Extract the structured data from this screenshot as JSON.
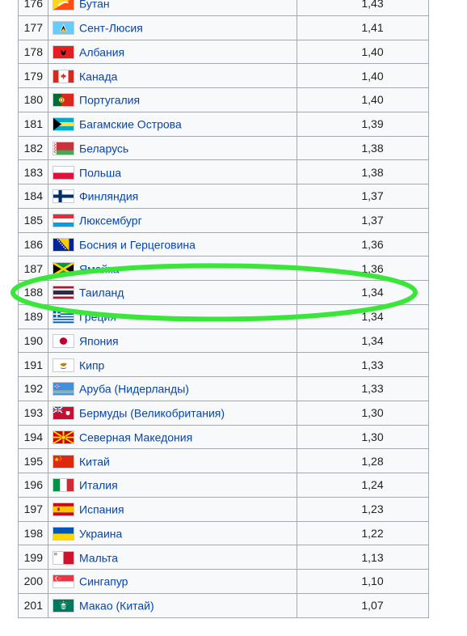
{
  "table": {
    "rows": [
      {
        "rank": "176",
        "country": "Бутан",
        "value": "1,43",
        "flag": "bhutan-flag-icon"
      },
      {
        "rank": "177",
        "country": "Сент-Люсия",
        "value": "1,41",
        "flag": "saint-lucia-flag-icon"
      },
      {
        "rank": "178",
        "country": "Албания",
        "value": "1,40",
        "flag": "albania-flag-icon"
      },
      {
        "rank": "179",
        "country": "Канада",
        "value": "1,40",
        "flag": "canada-flag-icon"
      },
      {
        "rank": "180",
        "country": "Португалия",
        "value": "1,40",
        "flag": "portugal-flag-icon"
      },
      {
        "rank": "181",
        "country": "Багамские Острова",
        "value": "1,39",
        "flag": "bahamas-flag-icon"
      },
      {
        "rank": "182",
        "country": "Беларусь",
        "value": "1,38",
        "flag": "belarus-flag-icon"
      },
      {
        "rank": "183",
        "country": "Польша",
        "value": "1,38",
        "flag": "poland-flag-icon"
      },
      {
        "rank": "184",
        "country": "Финляндия",
        "value": "1,37",
        "flag": "finland-flag-icon"
      },
      {
        "rank": "185",
        "country": "Люксембург",
        "value": "1,37",
        "flag": "luxembourg-flag-icon"
      },
      {
        "rank": "186",
        "country": "Босния и Герцеговина",
        "value": "1,36",
        "flag": "bosnia-flag-icon"
      },
      {
        "rank": "187",
        "country": "Ямайка",
        "value": "1,36",
        "flag": "jamaica-flag-icon"
      },
      {
        "rank": "188",
        "country": "Таиланд",
        "value": "1,34",
        "flag": "thailand-flag-icon"
      },
      {
        "rank": "189",
        "country": "Греция",
        "value": "1,34",
        "flag": "greece-flag-icon"
      },
      {
        "rank": "190",
        "country": "Япония",
        "value": "1,34",
        "flag": "japan-flag-icon"
      },
      {
        "rank": "191",
        "country": "Кипр",
        "value": "1,33",
        "flag": "cyprus-flag-icon"
      },
      {
        "rank": "192",
        "country": "Аруба (Нидерланды)",
        "value": "1,33",
        "flag": "aruba-flag-icon"
      },
      {
        "rank": "193",
        "country": "Бермуды (Великобритания)",
        "value": "1,30",
        "flag": "bermuda-flag-icon"
      },
      {
        "rank": "194",
        "country": "Северная Македония",
        "value": "1,30",
        "flag": "north-macedonia-flag-icon"
      },
      {
        "rank": "195",
        "country": "Китай",
        "value": "1,28",
        "flag": "china-flag-icon"
      },
      {
        "rank": "196",
        "country": "Италия",
        "value": "1,24",
        "flag": "italy-flag-icon"
      },
      {
        "rank": "197",
        "country": "Испания",
        "value": "1,23",
        "flag": "spain-flag-icon"
      },
      {
        "rank": "198",
        "country": "Украина",
        "value": "1,22",
        "flag": "ukraine-flag-icon"
      },
      {
        "rank": "199",
        "country": "Мальта",
        "value": "1,13",
        "flag": "malta-flag-icon"
      },
      {
        "rank": "200",
        "country": "Сингапур",
        "value": "1,10",
        "flag": "singapore-flag-icon"
      },
      {
        "rank": "201",
        "country": "Макао (Китай)",
        "value": "1,07",
        "flag": "macau-flag-icon"
      }
    ]
  },
  "highlight": {
    "rank": "188",
    "color": "#39e639"
  },
  "colors": {
    "link": "#0645ad",
    "cell_bg": "#f8f9fa",
    "border": "#a2a9b1"
  }
}
